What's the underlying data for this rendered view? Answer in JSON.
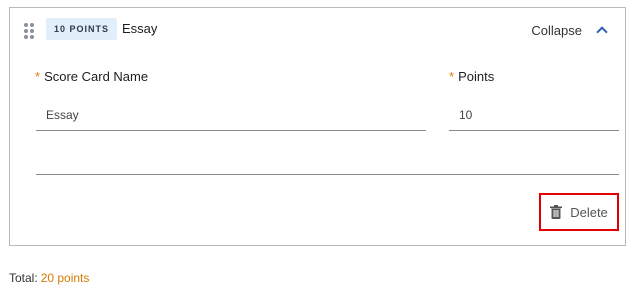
{
  "score_card": {
    "badge": "10 POINTS",
    "title": "Essay",
    "collapse_label": "Collapse",
    "fields": {
      "name_label": "Score Card Name",
      "name_value": "Essay",
      "points_label": "Points",
      "points_value": "10",
      "required_marker": "*",
      "extra_value": ""
    },
    "delete_label": "Delete"
  },
  "total": {
    "label": "Total:",
    "value": "20 points"
  },
  "colors": {
    "accent_orange": "#d87a00",
    "highlight_red": "#e00000",
    "badge_bg": "#e2eef9",
    "chevron_blue": "#2f5fb3"
  }
}
